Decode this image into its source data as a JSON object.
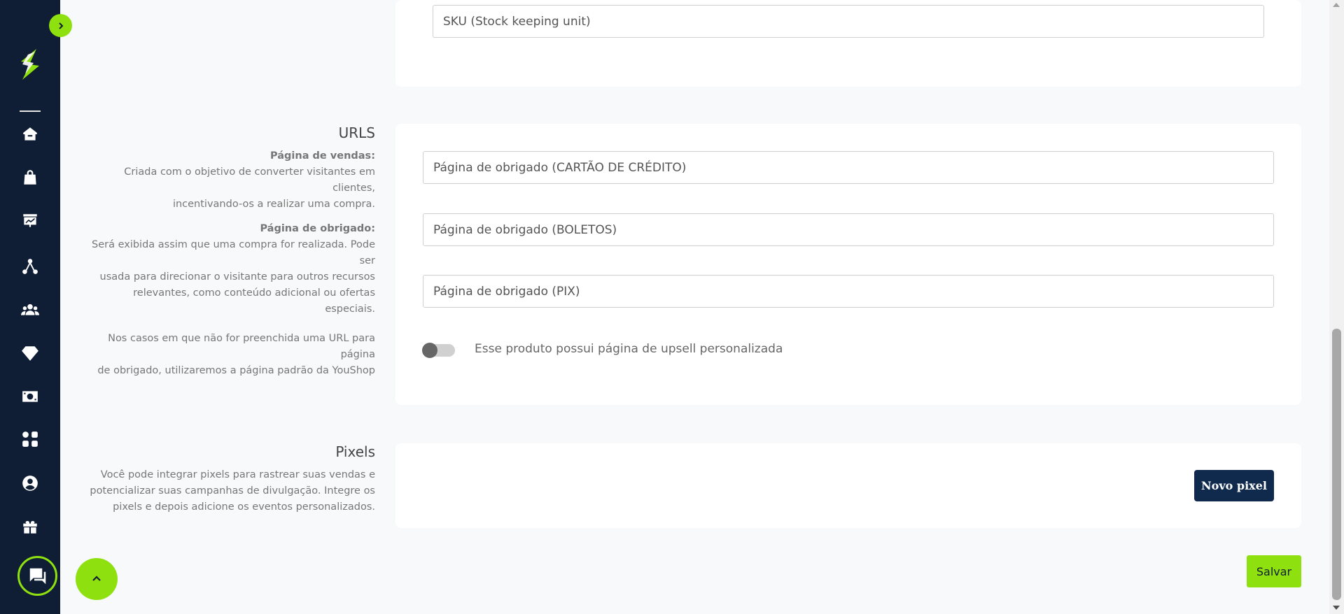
{
  "sku": {
    "placeholder": "SKU (Stock keeping unit)"
  },
  "urls": {
    "title": "URLS",
    "vendas_label": "Página de vendas:",
    "vendas_text_1": "Criada com o objetivo de converter visitantes em clientes,",
    "vendas_text_2": "incentivando-os a realizar uma compra.",
    "obrigado_label": "Página de obrigado:",
    "obrigado_text_1": "Será exibida assim que uma compra for realizada. Pode ser",
    "obrigado_text_2": "usada para direcionar o visitante para outros recursos",
    "obrigado_text_3": "relevantes, como conteúdo adicional ou ofertas especiais.",
    "default_text_1": "Nos casos em que não for preenchida uma URL para página",
    "default_text_2": "de obrigado, utilizaremos a página padrão da YouShop",
    "field_cartao": "Página de obrigado (CARTÃO DE CRÉDITO)",
    "field_boletos": "Página de obrigado (BOLETOS)",
    "field_pix": "Página de obrigado (PIX)",
    "upsell_label": "Esse produto possui página de upsell personalizada",
    "upsell_enabled": false
  },
  "pixels": {
    "title": "Pixels",
    "text_1": "Você pode integrar pixels para rastrear suas vendas e",
    "text_2": "potencializar suas campanhas de divulgação. Integre os",
    "text_3": "pixels e depois adicione os eventos personalizados.",
    "new_button": "Novo pixel"
  },
  "save_button": "Salvar",
  "sidebar": {
    "icons": [
      "home-icon",
      "shopping-bag-icon",
      "presentation-chart-icon",
      "network-icon",
      "users-icon",
      "diamond-icon",
      "money-icon",
      "apps-grid-icon",
      "user-circle-icon",
      "gift-icon"
    ]
  },
  "colors": {
    "sidebar": "#0f1e35",
    "accent": "#8fe00f",
    "primary_button": "#0f2a4d"
  }
}
